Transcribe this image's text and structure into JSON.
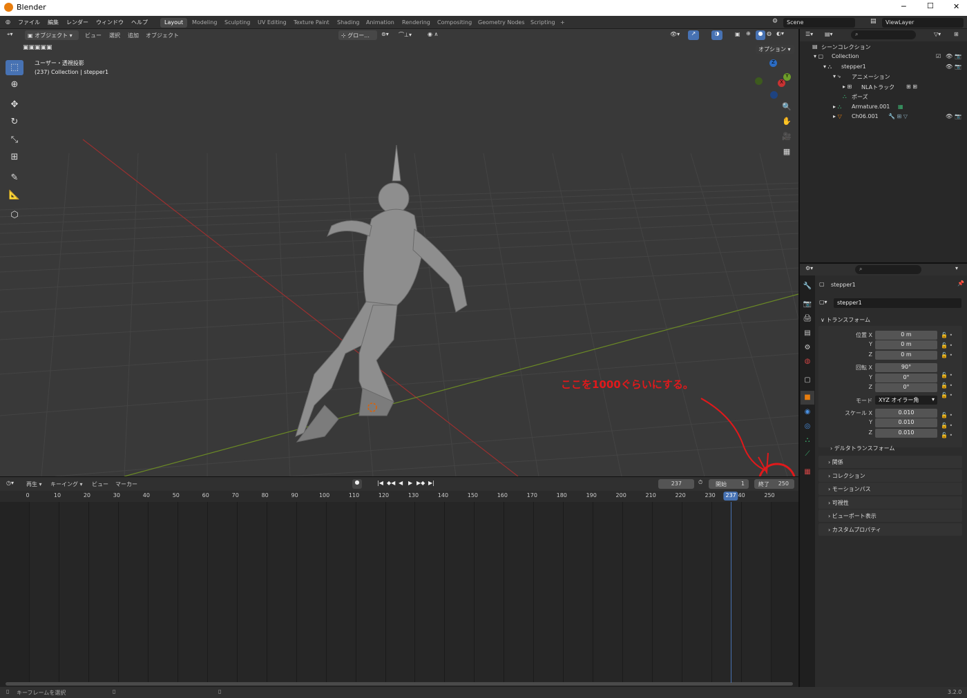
{
  "window": {
    "title": "Blender",
    "min": "─",
    "max": "☐",
    "close": "✕"
  },
  "menu": [
    "ファイル",
    "編集",
    "レンダー",
    "ウィンドウ",
    "ヘルプ"
  ],
  "workspaces": [
    "Layout",
    "Modeling",
    "Sculpting",
    "UV Editing",
    "Texture Paint",
    "Shading",
    "Animation",
    "Rendering",
    "Compositing",
    "Geometry Nodes",
    "Scripting"
  ],
  "add_ws": "+",
  "scene": {
    "name": "Scene",
    "view_layer": "ViewLayer"
  },
  "viewport": {
    "mode": "オブジェクト",
    "menus": [
      "ビュー",
      "選択",
      "追加",
      "オブジェクト"
    ],
    "transform_orient": "グロー...",
    "options": "オプション",
    "view_name": "ユーザー・透視投影",
    "object_info": "(237) Collection | stepper1",
    "annotation": "ここを1000ぐらいにする。",
    "gizmo": {
      "z": "Z",
      "y": "Y",
      "x": "X"
    }
  },
  "timeline": {
    "play_label": "再生",
    "keying_label": "キーイング",
    "view_label": "ビュー",
    "marker_label": "マーカー",
    "current_frame": "237",
    "start_label": "開始",
    "start": "1",
    "end_label": "終了",
    "end": "250",
    "ticks": [
      "0",
      "10",
      "20",
      "30",
      "40",
      "50",
      "60",
      "70",
      "80",
      "90",
      "100",
      "110",
      "120",
      "130",
      "140",
      "150",
      "160",
      "170",
      "180",
      "190",
      "200",
      "210",
      "220",
      "230",
      "240",
      "250"
    ],
    "playhead": "237",
    "current": 237
  },
  "outliner": {
    "scene_collection": "シーンコレクション",
    "rows": [
      {
        "label": "Collection"
      },
      {
        "label": "stepper1"
      },
      {
        "label": "アニメーション"
      },
      {
        "label": "NLAトラック"
      },
      {
        "label": "ポーズ"
      },
      {
        "label": "Armature.001"
      },
      {
        "label": "Ch06.001"
      }
    ]
  },
  "properties": {
    "object_name": "stepper1",
    "object_field": "stepper1",
    "transform_header": "トランスフォーム",
    "location_label": "位置 X",
    "location": [
      "0 m",
      "0 m",
      "0 m"
    ],
    "rotation_label": "回転 X",
    "rotation": [
      "90°",
      "0°",
      "0°"
    ],
    "mode_label": "モード",
    "mode": "XYZ オイラー角",
    "scale_label": "スケール X",
    "scale": [
      "0.010",
      "0.010",
      "0.010"
    ],
    "y_label": "Y",
    "z_label": "Z",
    "delta": "デルタトランスフォーム",
    "panels": [
      "関係",
      "コレクション",
      "モーションパス",
      "可視性",
      "ビューポート表示",
      "カスタムプロパティ"
    ]
  },
  "status": {
    "hint": "キーフレームを選択",
    "version": "3.2.0"
  },
  "colors": {
    "accent": "#4772b3",
    "annotation": "#e0191b",
    "x_axis": "#9a3030",
    "y_axis": "#6b8a25"
  }
}
